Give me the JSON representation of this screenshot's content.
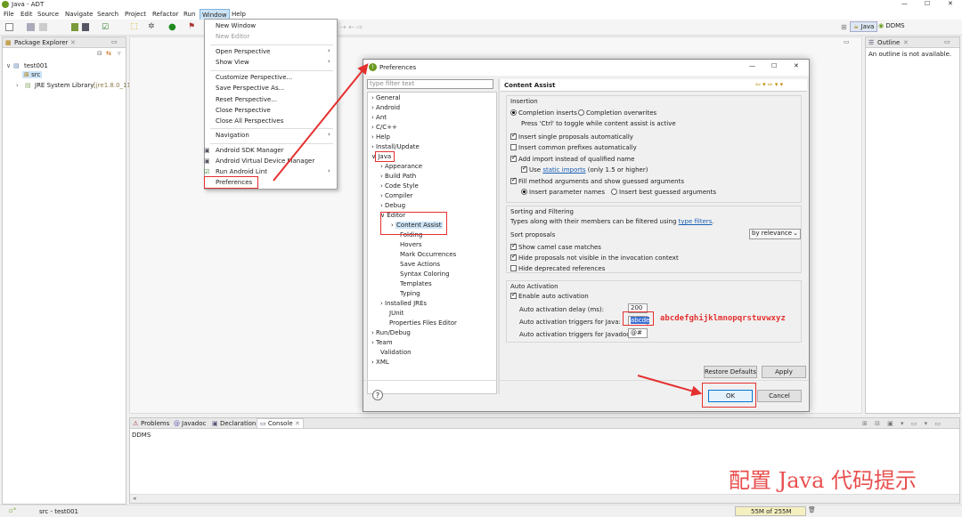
{
  "window": {
    "title": "Java - ADT"
  },
  "menubar": [
    "File",
    "Edit",
    "Source",
    "Navigate",
    "Search",
    "Project",
    "Refactor",
    "Run",
    "Window",
    "Help"
  ],
  "perspectives": {
    "java": "Java",
    "ddms": "DDMS"
  },
  "package_explorer": {
    "tab": "Package Explorer",
    "project": "test001",
    "src": "src",
    "jre": "JRE System Library",
    "jre_version": "[jre1.8.0_11"
  },
  "outline": {
    "tab": "Outline",
    "message": "An outline is not available."
  },
  "window_menu": {
    "items": [
      "New Window",
      "New Editor",
      "Open Perspective",
      "Show View",
      "Customize Perspective...",
      "Save Perspective As...",
      "Reset Perspective...",
      "Close Perspective",
      "Close All Perspectives",
      "Navigation",
      "Android SDK Manager",
      "Android Virtual Device Manager",
      "Run Android Lint",
      "Preferences"
    ]
  },
  "dialog": {
    "title": "Preferences",
    "filter_placeholder": "type filter text",
    "tree": [
      "General",
      "Android",
      "Ant",
      "C/C++",
      "Help",
      "Install/Update",
      "Java",
      "Appearance",
      "Build Path",
      "Code Style",
      "Compiler",
      "Debug",
      "Editor",
      "Content Assist",
      "Folding",
      "Hovers",
      "Mark Occurrences",
      "Save Actions",
      "Syntax Coloring",
      "Templates",
      "Typing",
      "Installed JREs",
      "JUnit",
      "Properties Files Editor",
      "Run/Debug",
      "Team",
      "Validation",
      "XML"
    ],
    "page_title": "Content Assist",
    "insertion": {
      "label": "Insertion",
      "completion_inserts": "Completion inserts",
      "completion_overwrites": "Completion overwrites",
      "toggle_hint": "Press 'Ctrl' to toggle while content assist is active",
      "single_proposals": "Insert single proposals automatically",
      "common_prefixes": "Insert common prefixes automatically",
      "add_import": "Add import instead of qualified name",
      "use": "Use",
      "static_imports": "static imports",
      "only_15": "(only 1.5 or higher)",
      "fill_args": "Fill method arguments and show guessed arguments",
      "insert_param_names": "Insert parameter names",
      "insert_best_guessed": "Insert best guessed arguments"
    },
    "sorting": {
      "label": "Sorting and Filtering",
      "types_hint": "Types along with their members can be filtered using",
      "type_filters": "type filters",
      "sort_proposals": "Sort proposals",
      "sort_value": "by relevance",
      "camel": "Show camel case matches",
      "hide_invisible": "Hide proposals not visible in the invocation context",
      "hide_deprecated": "Hide deprecated references"
    },
    "auto_activation": {
      "label": "Auto Activation",
      "enable": "Enable auto activation",
      "delay_label": "Auto activation delay (ms):",
      "delay_value": "200",
      "java_triggers_label": "Auto activation triggers for Java:",
      "java_triggers_value": "abcde",
      "javadoc_triggers_label": "Auto activation triggers for Javadoc:",
      "javadoc_triggers_value": "@#"
    },
    "restore_defaults": "Restore Defaults",
    "apply": "Apply",
    "ok": "OK",
    "cancel": "Cancel"
  },
  "annotation_text": "abcdefghijklmnopqrstuvwxyz",
  "bottom_tabs": [
    "Problems",
    "Javadoc",
    "Declaration",
    "Console"
  ],
  "console": {
    "label": "DDMS"
  },
  "watermark": "配置 Java 代码提示",
  "status": {
    "left": "src - test001",
    "memory": "55M of 255M"
  },
  "colors": {
    "annotation_red": "#e53030",
    "selection_blue": "#3b6fd1"
  }
}
